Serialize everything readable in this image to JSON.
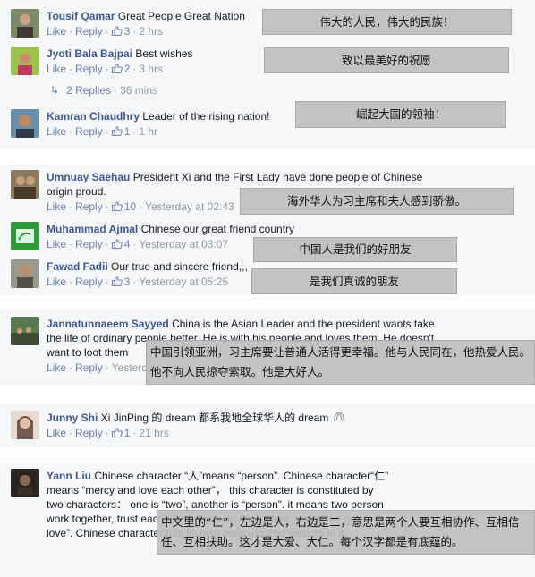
{
  "colors": {
    "link": "#3b5998",
    "meta": "#9197a3",
    "panel": "#f6f7f9",
    "overlay": "#bebebe"
  },
  "icons": {
    "like": "thumbs-up-icon",
    "reply_arrow": "reply-arrow-icon",
    "emoji": "flower-emoji-icon"
  },
  "labels": {
    "like": "Like",
    "reply": "Reply",
    "dot": "·"
  },
  "comments": [
    {
      "author": "Tousif Qamar",
      "text": "Great People Great Nation",
      "likes": "3",
      "time": "2 hrs",
      "translation": "伟大的人民，伟大的民族！"
    },
    {
      "author": "Jyoti Bala Bajpai",
      "text": "Best wishes",
      "likes": "2",
      "time": "3 hrs",
      "translation": "致以最美好的祝愿"
    },
    {
      "author": "Kamran Chaudhry",
      "text": "Leader of the rising nation!",
      "likes": "1",
      "time": "1 hr",
      "translation": "崛起大国的领袖！"
    },
    {
      "author": "Umnuay Saehau",
      "text": "President Xi and the First Lady have done people of Chinese origin proud.",
      "likes": "10",
      "time": "Yesterday at 02:43",
      "translation": "海外华人为习主席和夫人感到骄傲。"
    },
    {
      "author": "Muhammad Ajmal",
      "text": "Chinese our great friend country",
      "likes": "4",
      "time": "Yesterday at 03:07",
      "translation": "中国人是我们的好朋友"
    },
    {
      "author": "Fawad Fadii",
      "text": "Our true and sincere friend,,,",
      "likes": "3",
      "time": "Yesterday at 05:25",
      "translation": "是我们真诚的朋友"
    },
    {
      "author": "Jannatunnaeem Sayyed",
      "text": "China is the Asian Leader and the president wants take the life of ordinary people better. He is with his people and loves them. He doesn't want to loot them",
      "time": "Yesterday",
      "translation": "中国引领亚洲，习主席要让普通人活得更幸福。他与人民同在，他热爱人民。他不向人民掠夺索取。他是大好人。"
    },
    {
      "author": "Junny Shi",
      "text": "Xi JinPing 的 dream 都系我地全球华人的 dream",
      "likes": "1",
      "time": "21 hrs"
    },
    {
      "author": "Yann Liu",
      "text": "Chinese character “人”means “person”. Chinese character“仁” means “mercy and love each other”， this character is constituted by two characters： one is “two”, another is “person”. it means two person work together, trust each other and help each other. that is the great love”. Chinese character has its own meaning and wisdom in it.",
      "translation": "中文里的“仁”，左边是人，右边是二，意思是两个人要互相协作、互相信任、互相扶助。这才是大爱、大仁。每个汉字都是有底蕴的。"
    }
  ],
  "replies": {
    "count": "2 Replies",
    "time": "36 mins"
  }
}
